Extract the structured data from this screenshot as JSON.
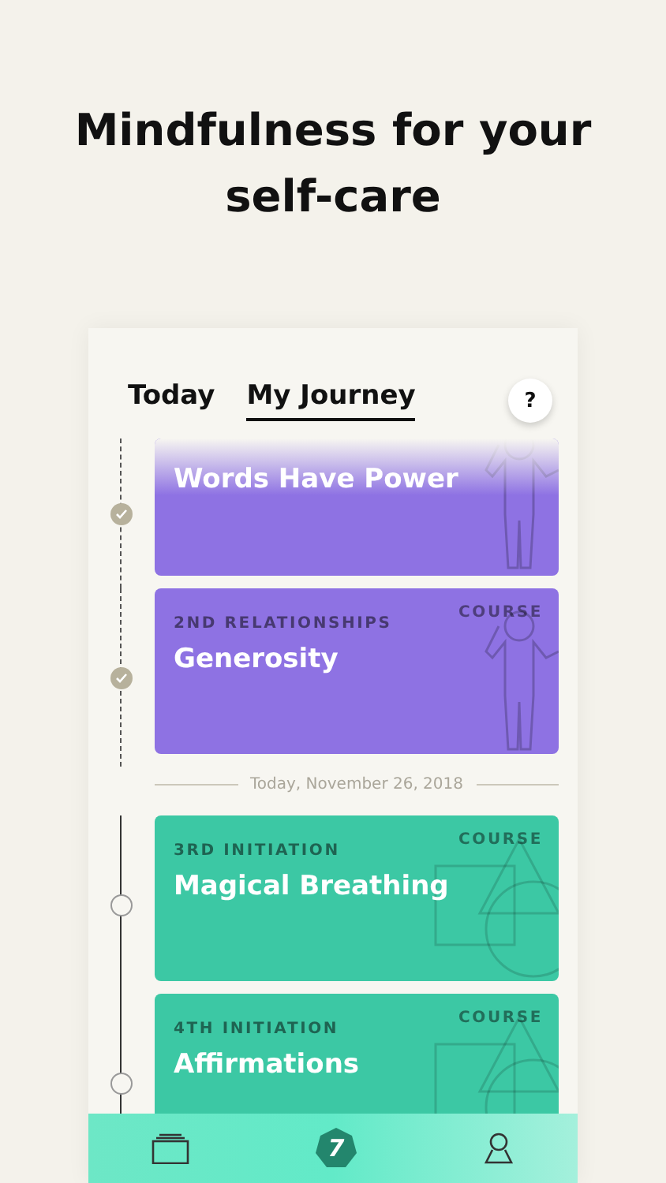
{
  "headline": "Mindfulness for your self-care",
  "tabs": [
    {
      "label": "Today",
      "selected": false
    },
    {
      "label": "My Journey",
      "selected": true
    }
  ],
  "help_button": "?",
  "entries": [
    {
      "title": "Words Have Power",
      "completed": true,
      "kind": "figure",
      "color": "#8e72e3",
      "cut": true
    },
    {
      "eyebrow": "2ND RELATIONSHIPS",
      "badge": "COURSE",
      "title": "Generosity",
      "completed": true,
      "kind": "figure",
      "color": "#8e72e3"
    },
    {
      "divider": "Today, November 26, 2018"
    },
    {
      "eyebrow": "3RD INITIATION",
      "badge": "COURSE",
      "title": "Magical Breathing",
      "completed": false,
      "kind": "shapes",
      "color": "#3cc8a4"
    },
    {
      "eyebrow": "4TH INITIATION",
      "badge": "COURSE",
      "title": "Affirmations",
      "completed": false,
      "kind": "shapes",
      "color": "#3cc8a4"
    }
  ],
  "bottom_nav": {
    "logo": "7"
  }
}
